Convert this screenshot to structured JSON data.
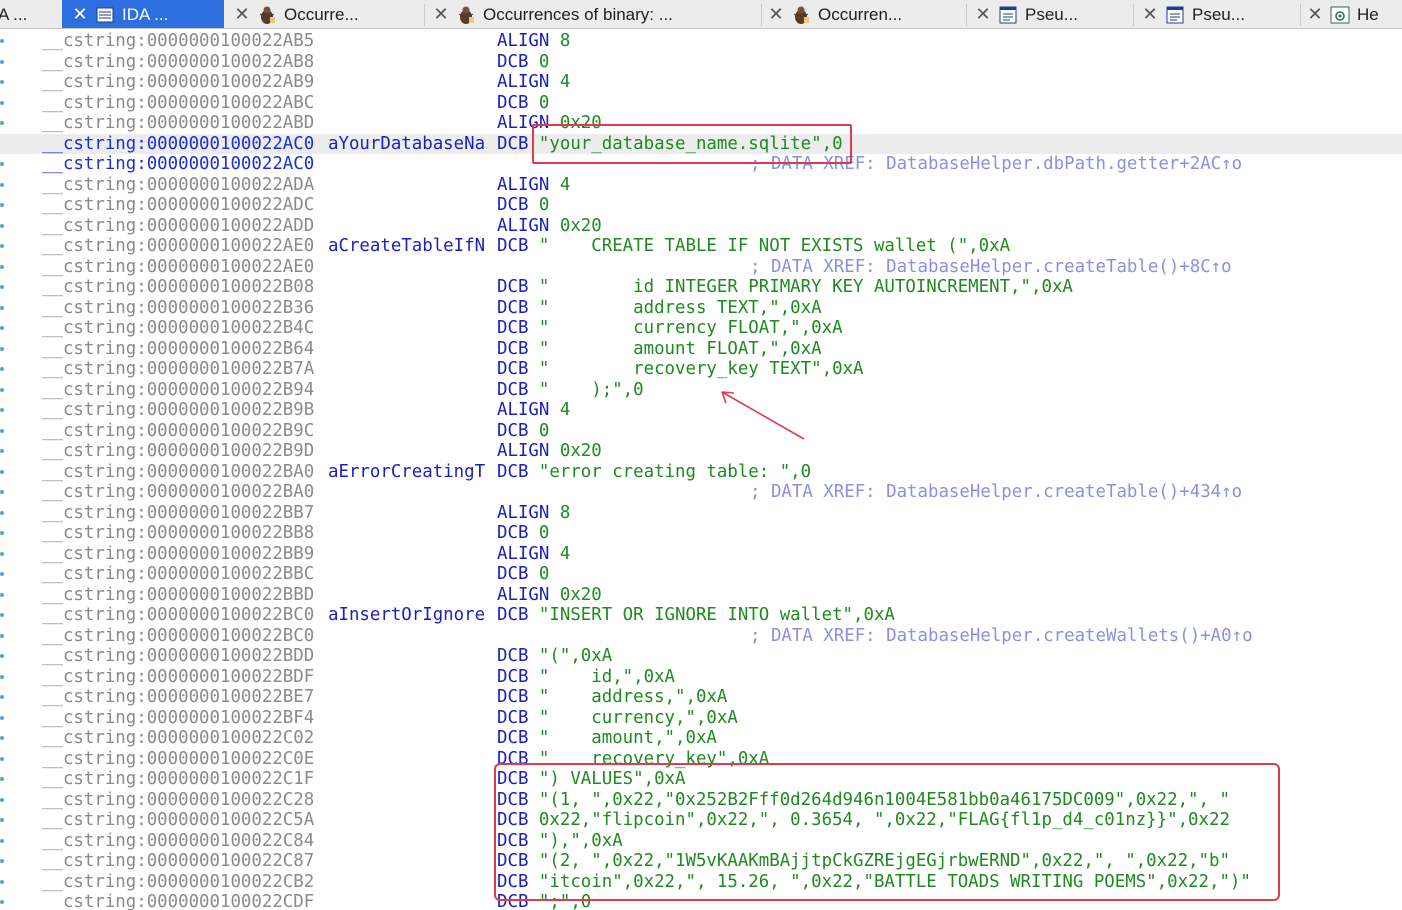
{
  "tabs": [
    {
      "label": "A ...",
      "icon": "none-icon",
      "close": false
    },
    {
      "label": "IDA ...",
      "icon": "ida-view-icon",
      "close": true,
      "active": true
    },
    {
      "label": "Occurre...",
      "icon": "bug-icon",
      "close": true
    },
    {
      "label": "Occurrences of binary: ...",
      "icon": "bug-icon",
      "close": true
    },
    {
      "label": "Occurren...",
      "icon": "bug-icon",
      "close": true
    },
    {
      "label": "Pseu...",
      "icon": "pseudocode-icon",
      "close": true
    },
    {
      "label": "Pseu...",
      "icon": "pseudocode-icon",
      "close": true
    },
    {
      "label": "He",
      "icon": "hex-view-icon",
      "close": true
    }
  ],
  "listing": [
    {
      "addr": "__cstring:0000000100022AB5",
      "name": "",
      "mnemonic": "ALIGN",
      "operand": "8",
      "comment": ""
    },
    {
      "addr": "__cstring:0000000100022AB8",
      "name": "",
      "mnemonic": "DCB",
      "operand": "0",
      "comment": ""
    },
    {
      "addr": "__cstring:0000000100022AB9",
      "name": "",
      "mnemonic": "ALIGN",
      "operand": "4",
      "comment": ""
    },
    {
      "addr": "__cstring:0000000100022ABC",
      "name": "",
      "mnemonic": "DCB",
      "operand": "0",
      "comment": ""
    },
    {
      "addr": "__cstring:0000000100022ABD",
      "name": "",
      "mnemonic": "ALIGN",
      "operand": "0x20",
      "comment": ""
    },
    {
      "addr": "__cstring:0000000100022AC0",
      "name": "aYourDatabaseNa",
      "mnemonic": "DCB",
      "operand": "\"your_database_name.sqlite\",0",
      "comment": "",
      "selected": true
    },
    {
      "addr": "__cstring:0000000100022AC0",
      "name": "",
      "mnemonic": "",
      "operand": "",
      "comment": "; DATA XREF: DatabaseHelper.dbPath.getter+2AC↑o",
      "selected": true
    },
    {
      "addr": "__cstring:0000000100022ADA",
      "name": "",
      "mnemonic": "ALIGN",
      "operand": "4",
      "comment": ""
    },
    {
      "addr": "__cstring:0000000100022ADC",
      "name": "",
      "mnemonic": "DCB",
      "operand": "0",
      "comment": ""
    },
    {
      "addr": "__cstring:0000000100022ADD",
      "name": "",
      "mnemonic": "ALIGN",
      "operand": "0x20",
      "comment": ""
    },
    {
      "addr": "__cstring:0000000100022AE0",
      "name": "aCreateTableIfN",
      "mnemonic": "DCB",
      "operand": "\"    CREATE TABLE IF NOT EXISTS wallet (\",0xA",
      "comment": ""
    },
    {
      "addr": "__cstring:0000000100022AE0",
      "name": "",
      "mnemonic": "",
      "operand": "",
      "comment": "; DATA XREF: DatabaseHelper.createTable()+8C↑o"
    },
    {
      "addr": "__cstring:0000000100022B08",
      "name": "",
      "mnemonic": "DCB",
      "operand": "\"        id INTEGER PRIMARY KEY AUTOINCREMENT,\",0xA",
      "comment": ""
    },
    {
      "addr": "__cstring:0000000100022B36",
      "name": "",
      "mnemonic": "DCB",
      "operand": "\"        address TEXT,\",0xA",
      "comment": ""
    },
    {
      "addr": "__cstring:0000000100022B4C",
      "name": "",
      "mnemonic": "DCB",
      "operand": "\"        currency FLOAT,\",0xA",
      "comment": ""
    },
    {
      "addr": "__cstring:0000000100022B64",
      "name": "",
      "mnemonic": "DCB",
      "operand": "\"        amount FLOAT,\",0xA",
      "comment": ""
    },
    {
      "addr": "__cstring:0000000100022B7A",
      "name": "",
      "mnemonic": "DCB",
      "operand": "\"        recovery_key TEXT\",0xA",
      "comment": ""
    },
    {
      "addr": "__cstring:0000000100022B94",
      "name": "",
      "mnemonic": "DCB",
      "operand": "\"    );\",0",
      "comment": ""
    },
    {
      "addr": "__cstring:0000000100022B9B",
      "name": "",
      "mnemonic": "ALIGN",
      "operand": "4",
      "comment": ""
    },
    {
      "addr": "__cstring:0000000100022B9C",
      "name": "",
      "mnemonic": "DCB",
      "operand": "0",
      "comment": ""
    },
    {
      "addr": "__cstring:0000000100022B9D",
      "name": "",
      "mnemonic": "ALIGN",
      "operand": "0x20",
      "comment": ""
    },
    {
      "addr": "__cstring:0000000100022BA0",
      "name": "aErrorCreatingT",
      "mnemonic": "DCB",
      "operand": "\"error creating table: \",0",
      "comment": ""
    },
    {
      "addr": "__cstring:0000000100022BA0",
      "name": "",
      "mnemonic": "",
      "operand": "",
      "comment": "; DATA XREF: DatabaseHelper.createTable()+434↑o"
    },
    {
      "addr": "__cstring:0000000100022BB7",
      "name": "",
      "mnemonic": "ALIGN",
      "operand": "8",
      "comment": ""
    },
    {
      "addr": "__cstring:0000000100022BB8",
      "name": "",
      "mnemonic": "DCB",
      "operand": "0",
      "comment": ""
    },
    {
      "addr": "__cstring:0000000100022BB9",
      "name": "",
      "mnemonic": "ALIGN",
      "operand": "4",
      "comment": ""
    },
    {
      "addr": "__cstring:0000000100022BBC",
      "name": "",
      "mnemonic": "DCB",
      "operand": "0",
      "comment": ""
    },
    {
      "addr": "__cstring:0000000100022BBD",
      "name": "",
      "mnemonic": "ALIGN",
      "operand": "0x20",
      "comment": ""
    },
    {
      "addr": "__cstring:0000000100022BC0",
      "name": "aInsertOrIgnore",
      "mnemonic": "DCB",
      "operand": "\"INSERT OR IGNORE INTO wallet\",0xA",
      "comment": ""
    },
    {
      "addr": "__cstring:0000000100022BC0",
      "name": "",
      "mnemonic": "",
      "operand": "",
      "comment": "; DATA XREF: DatabaseHelper.createWallets()+A0↑o"
    },
    {
      "addr": "__cstring:0000000100022BDD",
      "name": "",
      "mnemonic": "DCB",
      "operand": "\"(\",0xA",
      "comment": ""
    },
    {
      "addr": "__cstring:0000000100022BDF",
      "name": "",
      "mnemonic": "DCB",
      "operand": "\"    id,\",0xA",
      "comment": ""
    },
    {
      "addr": "__cstring:0000000100022BE7",
      "name": "",
      "mnemonic": "DCB",
      "operand": "\"    address,\",0xA",
      "comment": ""
    },
    {
      "addr": "__cstring:0000000100022BF4",
      "name": "",
      "mnemonic": "DCB",
      "operand": "\"    currency,\",0xA",
      "comment": ""
    },
    {
      "addr": "__cstring:0000000100022C02",
      "name": "",
      "mnemonic": "DCB",
      "operand": "\"    amount,\",0xA",
      "comment": ""
    },
    {
      "addr": "__cstring:0000000100022C0E",
      "name": "",
      "mnemonic": "DCB",
      "operand": "\"    recovery_key\",0xA",
      "comment": ""
    },
    {
      "addr": "__cstring:0000000100022C1F",
      "name": "",
      "mnemonic": "DCB",
      "operand": "\") VALUES\",0xA",
      "comment": ""
    },
    {
      "addr": "__cstring:0000000100022C28",
      "name": "",
      "mnemonic": "DCB",
      "operand": "\"(1, \",0x22,\"0x252B2Fff0d264d946n1004E581bb0a46175DC009\",0x22,\", \"",
      "comment": ""
    },
    {
      "addr": "__cstring:0000000100022C5A",
      "name": "",
      "mnemonic": "DCB",
      "operand": "0x22,\"flipcoin\",0x22,\", 0.3654, \",0x22,\"FLAG{fl1p_d4_c01nz}}\",0x22",
      "comment": ""
    },
    {
      "addr": "__cstring:0000000100022C84",
      "name": "",
      "mnemonic": "DCB",
      "operand": "\"),\",0xA",
      "comment": ""
    },
    {
      "addr": "__cstring:0000000100022C87",
      "name": "",
      "mnemonic": "DCB",
      "operand": "\"(2, \",0x22,\"1W5vKAAKmBAjjtpCkGZREjgEGjrbwERND\",0x22,\", \",0x22,\"b\"",
      "comment": ""
    },
    {
      "addr": "__cstring:0000000100022CB2",
      "name": "",
      "mnemonic": "DCB",
      "operand": "\"itcoin\",0x22,\", 15.26, \",0x22,\"BATTLE TOADS WRITING POEMS\",0x22,\")\"",
      "comment": ""
    },
    {
      "addr": "__cstring:0000000100022CDF",
      "name": "",
      "mnemonic": "DCB",
      "operand": "\";\",0",
      "comment": ""
    }
  ],
  "colors": {
    "accent_tab": "#2d6fde",
    "annotation": "#e03a4f",
    "address": "#8a8a8a",
    "name": "#1b1fbd",
    "string": "#1f8a1f",
    "comment": "#8b8fe0"
  }
}
